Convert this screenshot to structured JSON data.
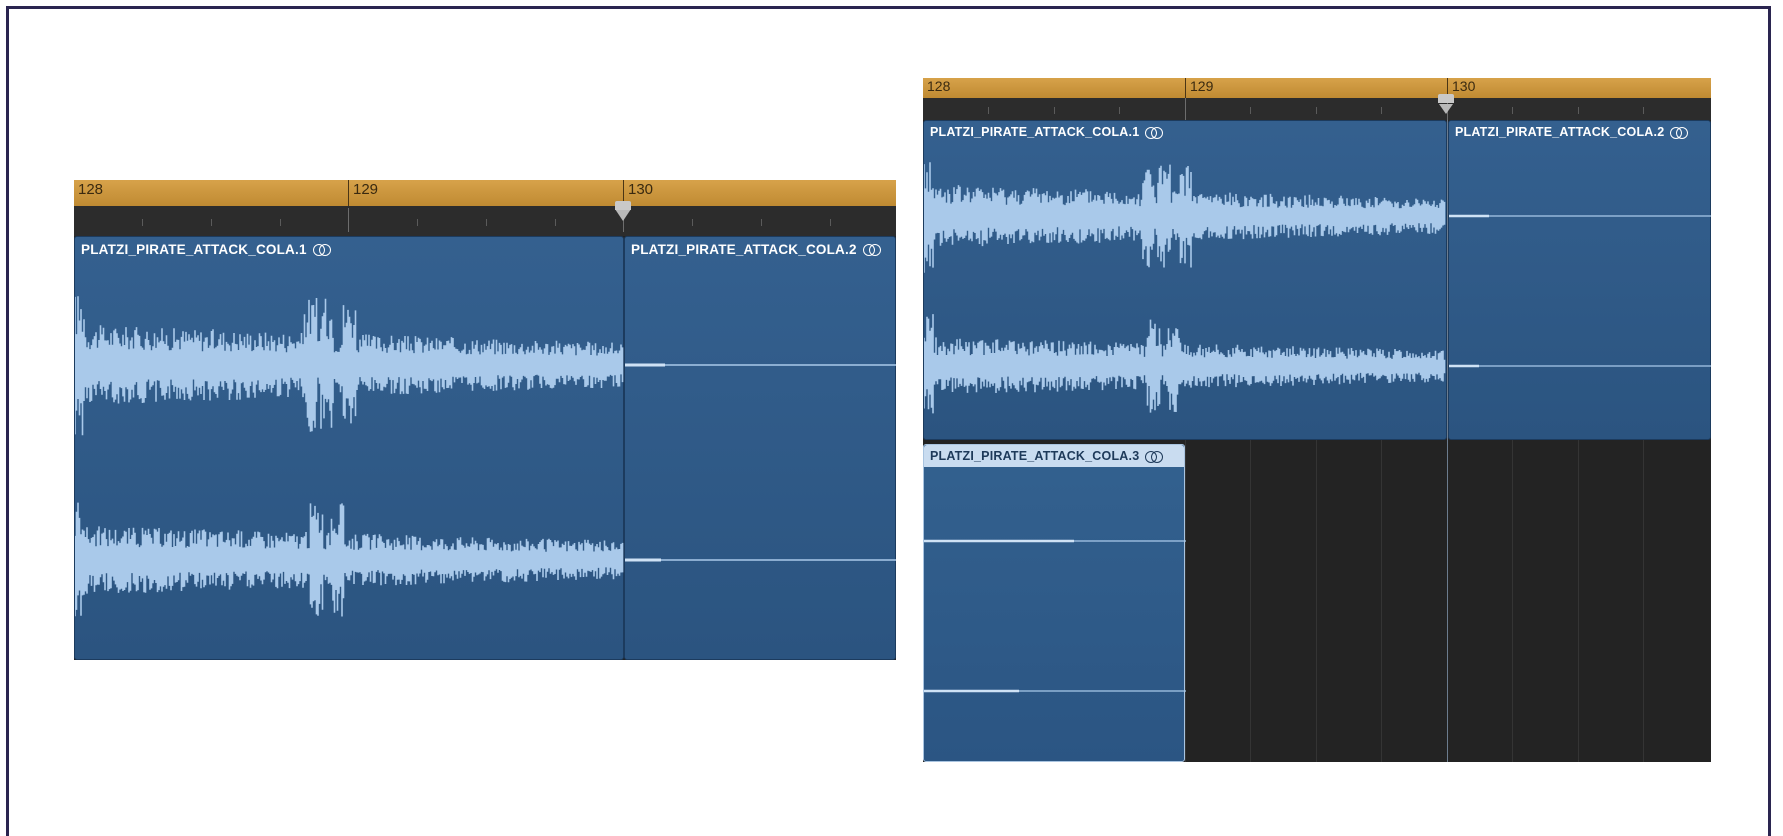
{
  "ruler_bars": [
    "128",
    "129",
    "130"
  ],
  "regions": {
    "r1": "PLATZI_PIRATE_ATTACK_COLA.1",
    "r2": "PLATZI_PIRATE_ATTACK_COLA.2",
    "r3": "PLATZI_PIRATE_ATTACK_COLA.3"
  },
  "icons": {
    "stereo": "stereo-link-icon",
    "playhead": "playhead-icon"
  },
  "colors": {
    "ruler": "#c9933c",
    "region": "#2f5b89",
    "waveform": "#a9c9ea",
    "background": "#232323"
  }
}
